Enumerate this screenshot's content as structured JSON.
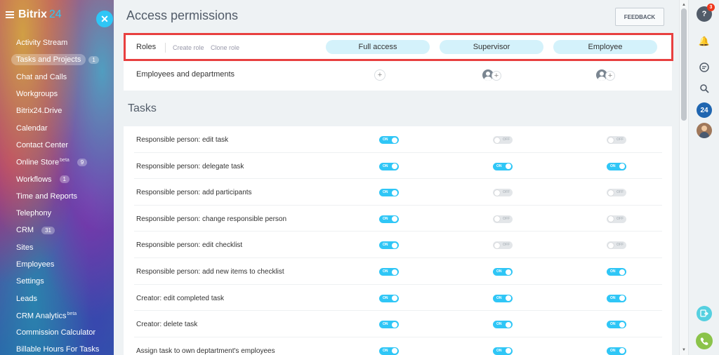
{
  "sidebar": {
    "brand_name": "Bitrix",
    "brand_num": "24",
    "items": [
      {
        "label": "Activity Stream",
        "count": "",
        "sup": "",
        "active": false
      },
      {
        "label": "Tasks and Projects",
        "count": "1",
        "sup": "",
        "active": true
      },
      {
        "label": "Chat and Calls",
        "count": "",
        "sup": "",
        "active": false
      },
      {
        "label": "Workgroups",
        "count": "",
        "sup": "",
        "active": false
      },
      {
        "label": "Bitrix24.Drive",
        "count": "",
        "sup": "",
        "active": false
      },
      {
        "label": "Calendar",
        "count": "",
        "sup": "",
        "active": false
      },
      {
        "label": "Contact Center",
        "count": "",
        "sup": "",
        "active": false
      },
      {
        "label": "Online Store",
        "count": "9",
        "sup": "beta",
        "active": false
      },
      {
        "label": "Workflows",
        "count": "1",
        "sup": "",
        "active": false
      },
      {
        "label": "Time and Reports",
        "count": "",
        "sup": "",
        "active": false
      },
      {
        "label": "Telephony",
        "count": "",
        "sup": "",
        "active": false
      },
      {
        "label": "CRM",
        "count": "31",
        "sup": "",
        "active": false
      },
      {
        "label": "Sites",
        "count": "",
        "sup": "",
        "active": false
      },
      {
        "label": "Employees",
        "count": "",
        "sup": "",
        "active": false
      },
      {
        "label": "Settings",
        "count": "",
        "sup": "",
        "active": false
      },
      {
        "label": "Leads",
        "count": "",
        "sup": "",
        "active": false
      },
      {
        "label": "CRM Analytics",
        "count": "",
        "sup": "beta",
        "active": false
      },
      {
        "label": "Commission Calculator",
        "count": "",
        "sup": "",
        "active": false
      },
      {
        "label": "Billable Hours For Tasks",
        "count": "",
        "sup": "",
        "active": false
      }
    ]
  },
  "header": {
    "title": "Access permissions",
    "feedback_label": "FEEDBACK"
  },
  "roles": {
    "label": "Roles",
    "create_role": "Create role",
    "clone_role": "Clone role",
    "columns": [
      "Full access",
      "Supervisor",
      "Employee"
    ]
  },
  "employees": {
    "label": "Employees and departments"
  },
  "tasks": {
    "title": "Tasks",
    "toggle_on_text": "ON",
    "toggle_off_text": "OFF",
    "rows": [
      {
        "label": "Responsible person: edit task",
        "values": [
          true,
          false,
          false
        ]
      },
      {
        "label": "Responsible person: delegate task",
        "values": [
          true,
          true,
          true
        ]
      },
      {
        "label": "Responsible person: add participants",
        "values": [
          true,
          false,
          false
        ]
      },
      {
        "label": "Responsible person: change responsible person",
        "values": [
          true,
          false,
          false
        ]
      },
      {
        "label": "Responsible person: edit checklist",
        "values": [
          true,
          false,
          false
        ]
      },
      {
        "label": "Responsible person: add new items to checklist",
        "values": [
          true,
          true,
          true
        ]
      },
      {
        "label": "Creator: edit completed task",
        "values": [
          true,
          true,
          true
        ]
      },
      {
        "label": "Creator: delete task",
        "values": [
          true,
          true,
          true
        ]
      },
      {
        "label": "Assign task to own deptartment's employees",
        "values": [
          true,
          true,
          true
        ]
      }
    ]
  },
  "right_panel": {
    "help_badge": "3",
    "b24_label": "24"
  },
  "colors": {
    "accent": "#2fc6f6",
    "highlight_border": "#e84040",
    "pill_bg": "#d4f2fb"
  }
}
